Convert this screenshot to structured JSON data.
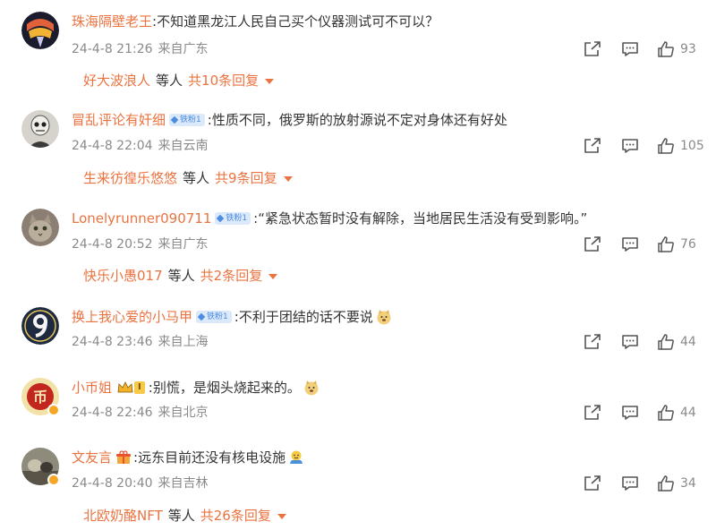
{
  "comments": [
    {
      "username": "珠海隔壁老王",
      "text": "不知道黑龙江人民自己买个仪器测试可不可以？",
      "date": "24-4-8 21:26",
      "source": "来自广东",
      "likes": "93",
      "replies": {
        "name": "好大波浪人",
        "mid": "等人",
        "total": "共10条回复"
      }
    },
    {
      "username": "冒乱评论有奸细",
      "badge": "铁粉1",
      "text": "性质不同，俄罗斯的放射源说不定对身体还有好处",
      "date": "24-4-8 22:04",
      "source": "来自云南",
      "likes": "105",
      "replies": {
        "name": "生来彷徨乐悠悠",
        "mid": "等人",
        "total": "共9条回复"
      }
    },
    {
      "username": "Lonelyrunner090711",
      "badge": "铁粉1",
      "text": "“紧急状态暂时没有解除，当地居民生活没有受到影响。”",
      "date": "24-4-8 20:52",
      "source": "来自广东",
      "likes": "76",
      "replies": {
        "name": "快乐小愚017",
        "mid": "等人",
        "total": "共2条回复"
      }
    },
    {
      "username": "换上我心爱的小马甲",
      "badge": "铁粉1",
      "text": "不利于团结的话不要说",
      "date": "24-4-8 23:46",
      "source": "来自上海",
      "likes": "44"
    },
    {
      "username": "小币姐",
      "level": "I",
      "text": "别慌，是烟头烧起来的。",
      "date": "24-4-8 22:46",
      "source": "来自北京",
      "likes": "44"
    },
    {
      "username": "文友言",
      "text": "远东目前还没有核电设施",
      "date": "24-4-8 20:40",
      "source": "来自吉林",
      "likes": "34",
      "replies": {
        "name": "北欧奶酪NFT",
        "mid": "等人",
        "total": "共26条回复"
      }
    }
  ],
  "colors": {
    "username": "#eb7340",
    "meta": "#8a8a8a",
    "text": "#333333",
    "fan_badge_bg": "#dbe9fb",
    "fan_badge_text": "#4b8be0"
  },
  "icons": {
    "share": "share-icon",
    "comment": "comment-icon",
    "like": "thumbs-up-icon",
    "expand": "chevron-down-icon"
  }
}
